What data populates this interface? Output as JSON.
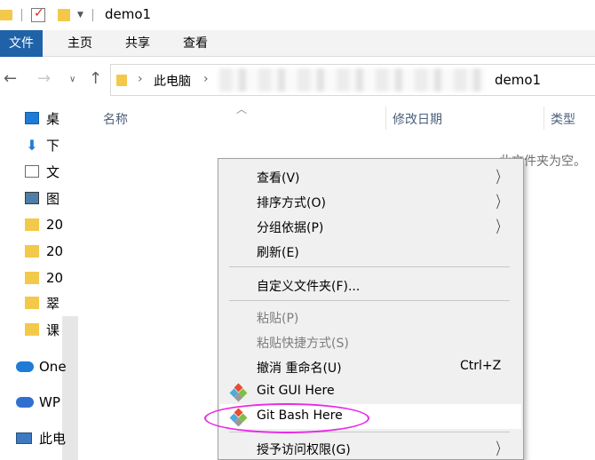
{
  "window": {
    "title": "demo1"
  },
  "ribbon": {
    "tabs": [
      "文件",
      "主页",
      "共享",
      "查看"
    ],
    "active_color": "#1f62a8"
  },
  "address": {
    "crumb_pc": "此电脑",
    "crumb_current": "demo1"
  },
  "nav_pane": {
    "items": [
      {
        "label": "桌",
        "icon": "desktop-icon"
      },
      {
        "label": "下",
        "icon": "download-icon"
      },
      {
        "label": "文",
        "icon": "document-icon"
      },
      {
        "label": "图",
        "icon": "picture-icon"
      },
      {
        "label": "20",
        "icon": "folder-icon"
      },
      {
        "label": "20",
        "icon": "folder-icon"
      },
      {
        "label": "20",
        "icon": "folder-icon"
      },
      {
        "label": "翠",
        "icon": "folder-icon"
      },
      {
        "label": "课",
        "icon": "folder-icon"
      },
      {
        "label": "One",
        "icon": "onedrive-icon"
      },
      {
        "label": "WP",
        "icon": "wps-cloud-icon"
      },
      {
        "label": "此电",
        "icon": "this-pc-icon"
      }
    ]
  },
  "columns": {
    "name": "名称",
    "date": "修改日期",
    "type": "类型"
  },
  "empty_message": "此文件夹为空。",
  "context_menu": {
    "items": [
      {
        "label": "查看(V)",
        "submenu": true
      },
      {
        "label": "排序方式(O)",
        "submenu": true
      },
      {
        "label": "分组依据(P)",
        "submenu": true
      },
      {
        "label": "刷新(E)"
      },
      {
        "label": "自定义文件夹(F)..."
      },
      {
        "label": "粘贴(P)",
        "disabled": true
      },
      {
        "label": "粘贴快捷方式(S)",
        "disabled": true
      },
      {
        "label": "撤消 重命名(U)",
        "shortcut": "Ctrl+Z"
      },
      {
        "label": "Git GUI Here",
        "icon": "git-icon"
      },
      {
        "label": "Git Bash Here",
        "icon": "git-icon",
        "highlighted": true
      },
      {
        "label": "授予访问权限(G)",
        "submenu": true
      }
    ]
  },
  "annotation_color": "#e829e8"
}
